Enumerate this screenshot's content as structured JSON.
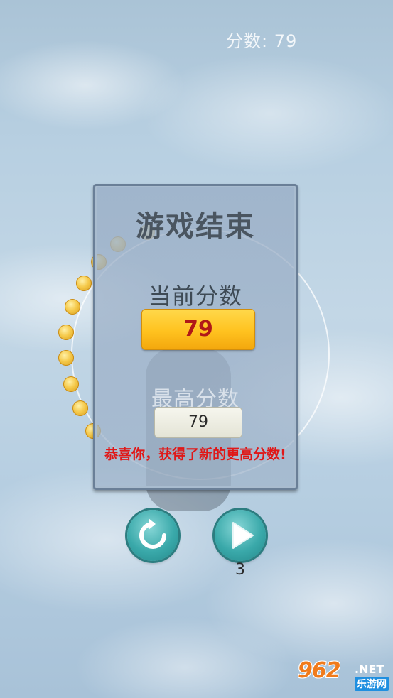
{
  "hud": {
    "score_text": "分数: 79"
  },
  "panel": {
    "title": "游戏结束",
    "current_score_label": "当前分数",
    "current_score": "79",
    "best_score_label": "最高分数",
    "best_score": "79",
    "congrats_message": "恭喜你，获得了新的更高分数!"
  },
  "buttons": {
    "restart_icon": "restart-icon",
    "continue_icon": "play-icon",
    "continue_count": "3"
  },
  "watermark": {
    "main": "962",
    "net": ".NET",
    "sub": "乐游网"
  },
  "colors": {
    "accent_yellow": "#ffc21f",
    "score_red": "#b01818",
    "congrats_red": "#e01818",
    "button_teal": "#3aa9aa"
  }
}
